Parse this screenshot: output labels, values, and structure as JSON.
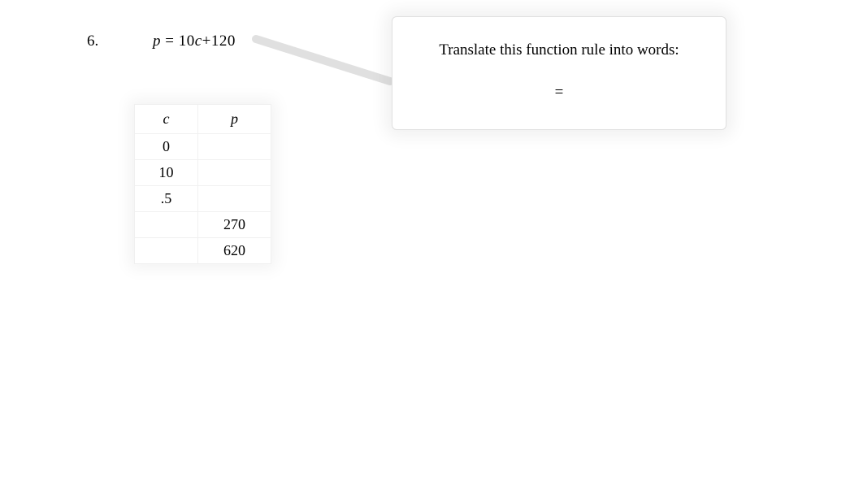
{
  "problem": {
    "number": "6.",
    "equation_lhs_var": "p",
    "equation_eq": " = ",
    "equation_rhs_coef": "10",
    "equation_rhs_var": "c",
    "equation_rhs_plus": "+120"
  },
  "callout": {
    "title": "Translate this function rule into words:",
    "equals": "="
  },
  "table": {
    "header_c": "c",
    "header_p": "p",
    "rows": [
      {
        "c": "0",
        "p": ""
      },
      {
        "c": "10",
        "p": ""
      },
      {
        "c": ".5",
        "p": ""
      },
      {
        "c": "",
        "p": "270"
      },
      {
        "c": "",
        "p": "620"
      }
    ]
  }
}
